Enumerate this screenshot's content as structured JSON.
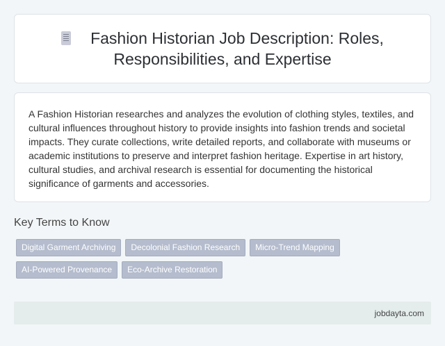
{
  "header": {
    "icon": "document-icon",
    "title": "Fashion Historian Job Description: Roles, Responsibilities, and Expertise"
  },
  "description": "A Fashion Historian researches and analyzes the evolution of clothing styles, textiles, and cultural influences throughout history to provide insights into fashion trends and societal impacts. They curate collections, write detailed reports, and collaborate with museums or academic institutions to preserve and interpret fashion heritage. Expertise in art history, cultural studies, and archival research is essential for documenting the historical significance of garments and accessories.",
  "key_terms": {
    "heading": "Key Terms to Know",
    "items": [
      "Digital Garment Archiving",
      "Decolonial Fashion Research",
      "Micro-Trend Mapping",
      "AI-Powered Provenance",
      "Eco-Archive Restoration"
    ]
  },
  "footer": {
    "site": "jobdayta.com"
  },
  "colors": {
    "background": "#f3f6f8",
    "chip": "#b4bccd",
    "footer": "#e4ecec"
  }
}
